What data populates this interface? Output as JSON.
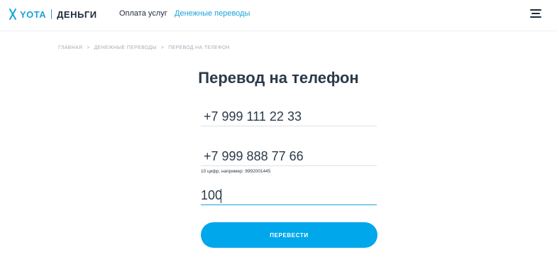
{
  "header": {
    "logo_yota": "YOTA",
    "logo_dengi": "ДЕНЬГИ",
    "nav": [
      {
        "label": "Оплата услуг"
      },
      {
        "label": "Денежные переводы"
      }
    ],
    "menu_icon": "hamburger-menu-icon",
    "accent_color": "#1ba3dc"
  },
  "breadcrumb": {
    "items": [
      "ГЛАВНАЯ",
      "ДЕНЕЖНЫЕ ПЕРЕВОДЫ",
      "ПЕРЕВОД НА ТЕЛЕФОН"
    ],
    "separator": ">"
  },
  "page": {
    "title": "Перевод на телефон"
  },
  "form": {
    "from_phone": "+7 999 111 22 33",
    "to_phone": "+7 999 888 77 66",
    "to_phone_hint": "10 цифр, например: 9992001445",
    "amount": "100",
    "submit_label": "ПЕРЕВЕСТИ",
    "button_color": "#00a7eb"
  }
}
